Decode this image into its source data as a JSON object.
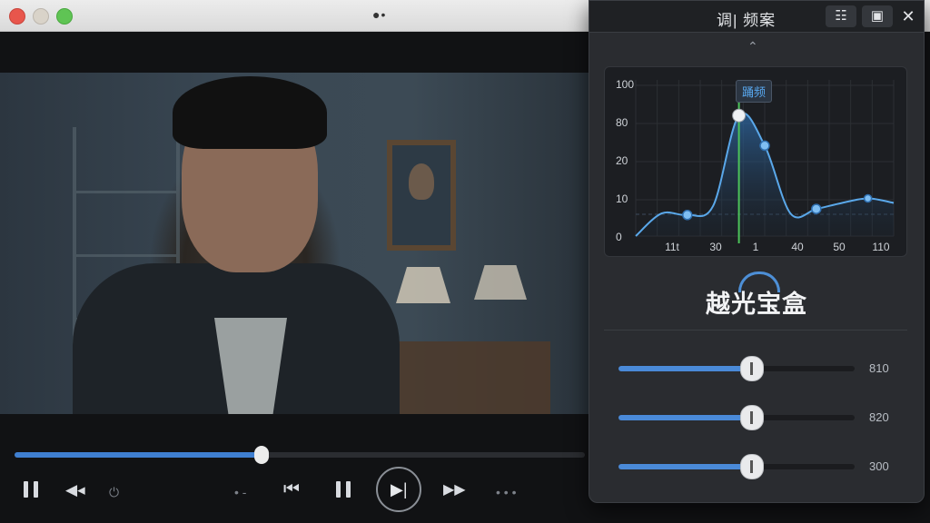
{
  "player": {
    "title_glyph": "●•",
    "progress": 0.433,
    "controls": {
      "pause_left": "",
      "prev_small": "◀◂",
      "power": "⏻",
      "dots_left": "• -",
      "skip_back": "⏮",
      "pause_center": "",
      "play_pause": "▶|",
      "fast_forward": "▶▶",
      "dots_right": "• • •"
    }
  },
  "panel": {
    "title": "调| 频案",
    "header_buttons": [
      "☷",
      "▣",
      "✕"
    ],
    "collapse_chevron": "⌃",
    "eq": {
      "tooltip": "踊频",
      "y_ticks": [
        "100",
        "80",
        "20",
        "10",
        "0"
      ],
      "x_ticks": [
        "11t",
        "30",
        "1",
        "40",
        "50",
        "110"
      ]
    },
    "brand": "越光宝盒",
    "sliders": [
      {
        "value_label": "810",
        "level": 0.56
      },
      {
        "value_label": "820",
        "level": 0.56
      },
      {
        "value_label": "300",
        "level": 0.56
      }
    ]
  },
  "colors": {
    "accent": "#4a8ad8",
    "marker": "#4cc35a",
    "curve": "#5aa8ea"
  },
  "chart_data": {
    "type": "area",
    "x": [
      0,
      1,
      2,
      3,
      4,
      5,
      6,
      7,
      8,
      9,
      10
    ],
    "y": [
      0,
      15,
      14,
      20,
      80,
      60,
      15,
      18,
      22,
      25,
      22
    ],
    "x_tick_labels": [
      "11t",
      "30",
      "1",
      "40",
      "50",
      "110"
    ],
    "y_tick_labels": [
      "100",
      "80",
      "20",
      "10",
      "0"
    ],
    "marker_at": "1",
    "tooltip": "踊频",
    "grid": true
  }
}
